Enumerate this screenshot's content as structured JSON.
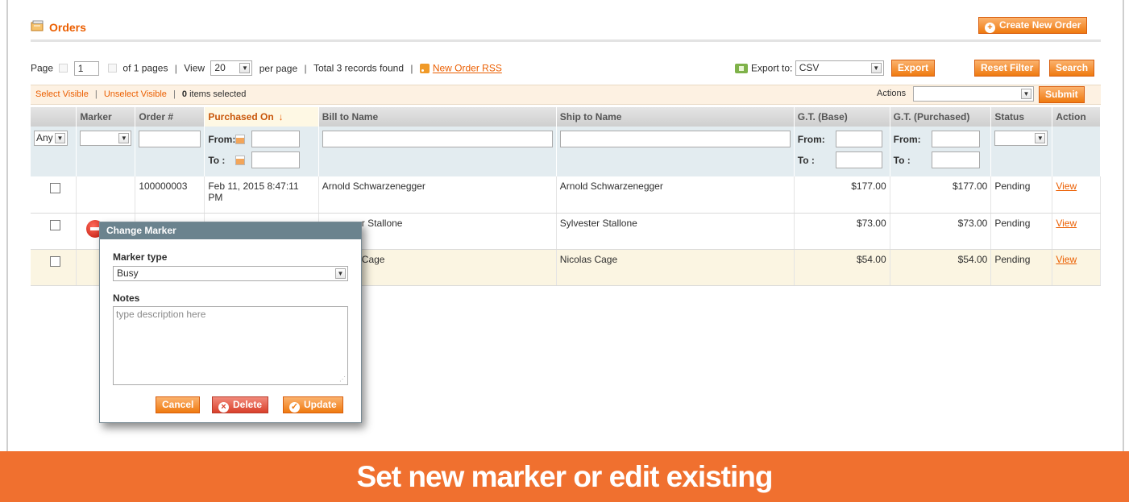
{
  "header": {
    "title": "Orders",
    "create_order_label": "Create New Order"
  },
  "pager": {
    "page_label": "Page",
    "page_value": "1",
    "of_pages": "of 1 pages",
    "view_label": "View",
    "per_page_value": "20",
    "per_page_label": "per page",
    "total_records": "Total 3 records found",
    "rss_label": "New Order RSS"
  },
  "export": {
    "label": "Export to:",
    "format": "CSV",
    "button_label": "Export"
  },
  "toolbar": {
    "reset_filter_label": "Reset Filter",
    "search_label": "Search"
  },
  "massaction": {
    "select_visible": "Select Visible",
    "unselect_visible": "Unselect Visible",
    "selected_count": "0",
    "selected_suffix": "items selected",
    "actions_label": "Actions",
    "submit_label": "Submit"
  },
  "grid": {
    "columns": [
      "Marker",
      "Order #",
      "Purchased On",
      "Bill to Name",
      "Ship to Name",
      "G.T. (Base)",
      "G.T. (Purchased)",
      "Status",
      "Action"
    ],
    "filter": {
      "any_label": "Any",
      "from_label": "From:",
      "to_label": "To :"
    },
    "rows": [
      {
        "order": "100000003",
        "purchased_on": "Feb 11, 2015 8:47:11 PM",
        "bill_to": "Arnold Schwarzenegger",
        "ship_to": "Arnold Schwarzenegger",
        "gt_base": "$177.00",
        "gt_purchased": "$177.00",
        "status": "Pending",
        "action": "View"
      },
      {
        "order": "",
        "purchased_on": "",
        "bill_to": "r Stallone",
        "ship_to": "Sylvester Stallone",
        "gt_base": "$73.00",
        "gt_purchased": "$73.00",
        "status": "Pending",
        "action": "View"
      },
      {
        "order": "",
        "purchased_on": "",
        "bill_to": "Cage",
        "ship_to": "Nicolas Cage",
        "gt_base": "$54.00",
        "gt_purchased": "$54.00",
        "status": "Pending",
        "action": "View"
      }
    ]
  },
  "dialog": {
    "title": "Change Marker",
    "marker_type_label": "Marker type",
    "marker_type_value": "Busy",
    "notes_label": "Notes",
    "notes_placeholder": "type description here",
    "cancel_label": "Cancel",
    "delete_label": "Delete",
    "update_label": "Update"
  },
  "banner": {
    "text": "Set new marker or edit existing"
  },
  "colors": {
    "accent": "#eb5e00",
    "button": "#ef7a10",
    "danger": "#d9402b",
    "dialog_header": "#6b838e",
    "banner": "#f0702f",
    "row_highlight": "#fbf5e2"
  }
}
